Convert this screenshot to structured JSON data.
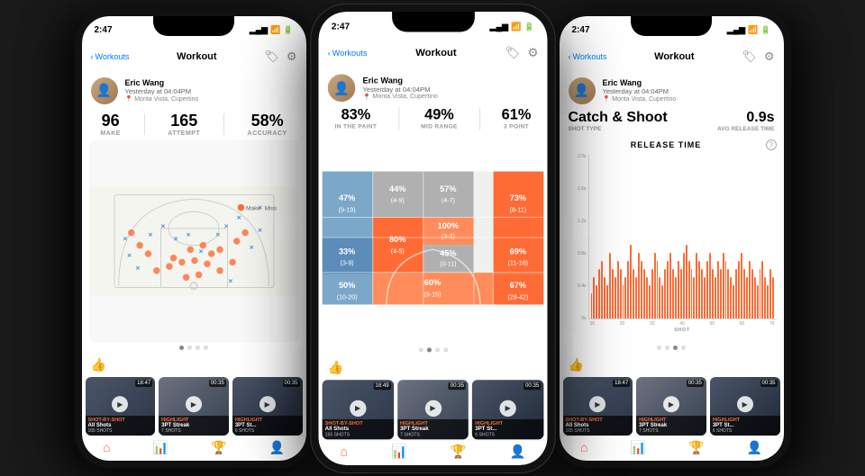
{
  "phones": [
    {
      "id": "phone1",
      "status": {
        "time": "2:47",
        "battery": "█████",
        "signal": "●●●●"
      },
      "nav": {
        "back_label": "Workouts",
        "title": "Workout",
        "tag_icon": "🏷",
        "gear_icon": "⚙"
      },
      "profile": {
        "name": "Eric Wang",
        "date": "Yesterday at 04:04PM",
        "location": "Monta Vista, Cupertino"
      },
      "stats": [
        {
          "value": "96",
          "label": "MAKE"
        },
        {
          "value": "165",
          "label": "ATTEMPT"
        },
        {
          "value": "58%",
          "label": "ACCURACY"
        }
      ],
      "chart_type": "shot_chart",
      "pagination": [
        true,
        false,
        false,
        false
      ],
      "videos": [
        {
          "duration": "18:47",
          "type": "SHOT-BY-SHOT",
          "name": "All Shots",
          "count": "165 SHOTS",
          "bg": "vbg1"
        },
        {
          "duration": "00:35",
          "type": "HIGHLIGHT",
          "name": "3PT Streak",
          "count": "7 SHOTS",
          "bg": "vbg2"
        },
        {
          "duration": "00:35",
          "type": "HIGHLIGHT",
          "name": "3PT St...",
          "count": "6 SHOTS",
          "bg": "vbg3"
        }
      ]
    },
    {
      "id": "phone2",
      "status": {
        "time": "2:47",
        "battery": "█████",
        "signal": "●●●●"
      },
      "nav": {
        "back_label": "Workouts",
        "title": "Workout",
        "tag_icon": "🏷",
        "gear_icon": "⚙"
      },
      "profile": {
        "name": "Eric Wang",
        "date": "Yesterday at 04:04PM",
        "location": "Monta Vista, Cupertino"
      },
      "pct_stats": [
        {
          "value": "83%",
          "label": "IN THE PAINT"
        },
        {
          "value": "49%",
          "label": "MID RANGE"
        },
        {
          "value": "61%",
          "label": "3 POINT"
        }
      ],
      "chart_type": "zones",
      "zones": [
        {
          "pct": "57%",
          "frac": "(4-7)",
          "color": "neutral",
          "col": 3,
          "row": 1
        },
        {
          "pct": "44%",
          "frac": "(4-9)",
          "color": "neutral",
          "col": 2,
          "row": 1
        },
        {
          "pct": "47%",
          "frac": "(9-19)",
          "color": "medium",
          "col": 1,
          "row": 1
        },
        {
          "pct": "73%",
          "frac": "(8-11)",
          "color": "hot",
          "col": 4,
          "row": 1
        },
        {
          "pct": "33%",
          "frac": "(3-9)",
          "color": "cool",
          "col": 2,
          "row": 2
        },
        {
          "pct": "80%",
          "frac": "(4-5)",
          "color": "hot",
          "col": 3,
          "row": 2
        },
        {
          "pct": "100%",
          "frac": "(3-3)",
          "color": "hot",
          "col": 2,
          "row": 2
        },
        {
          "pct": "45%",
          "frac": "(0-11)",
          "color": "neutral",
          "col": 3,
          "row": 2
        },
        {
          "pct": "50%",
          "frac": "(10-20)",
          "color": "medium",
          "col": 1,
          "row": 3
        },
        {
          "pct": "60%",
          "frac": "(9-15)",
          "color": "warm",
          "col": 2,
          "row": 3
        },
        {
          "pct": "67%",
          "frac": "(28-42)",
          "color": "warm",
          "col": 2,
          "row": 3
        },
        {
          "pct": "69%",
          "frac": "(11-16)",
          "color": "hot",
          "col": 3,
          "row": 3
        }
      ],
      "pagination": [
        false,
        true,
        false,
        false
      ],
      "videos": [
        {
          "duration": "18:49",
          "type": "SHOT-BY-SHOT",
          "name": "All Shots",
          "count": "165 SHOTS",
          "bg": "vbg1"
        },
        {
          "duration": "00:35",
          "type": "HIGHLIGHT",
          "name": "3PT Streak",
          "count": "7 SHOTS",
          "bg": "vbg2"
        },
        {
          "duration": "00:35",
          "type": "HIGHLIGHT",
          "name": "3PT St...",
          "count": "6 SHOTS",
          "bg": "vbg3"
        }
      ]
    },
    {
      "id": "phone3",
      "status": {
        "time": "2:47",
        "battery": "█████",
        "signal": "●●●●"
      },
      "nav": {
        "back_label": "Workouts",
        "title": "Workout",
        "tag_icon": "🏷",
        "gear_icon": "⚙"
      },
      "profile": {
        "name": "Eric Wang",
        "date": "Yesterday at 04:04PM",
        "location": "Monta Vista, Cupertino"
      },
      "catch_shoot": {
        "title": "Catch & Shoot",
        "shot_type_label": "SHOT TYPE",
        "value": "0.9s",
        "avg_label": "AVG RELEASE TIME"
      },
      "release_chart": {
        "title": "RELEASE TIME",
        "y_label": "RELEASE TIME",
        "x_labels": [
          "10",
          "20",
          "30",
          "40",
          "50",
          "60",
          "70"
        ],
        "x_axis_label": "SHOT",
        "y_axis_labels": [
          "2.0s",
          "1.6s",
          "1.2s",
          "0.8s",
          "0.4s",
          "0s"
        ],
        "bars": [
          0.3,
          0.5,
          0.4,
          0.6,
          0.7,
          0.5,
          0.4,
          0.8,
          0.6,
          0.5,
          0.7,
          0.6,
          0.4,
          0.5,
          0.7,
          0.9,
          0.6,
          0.5,
          0.8,
          0.7,
          0.6,
          0.5,
          0.4,
          0.6,
          0.8,
          0.7,
          0.5,
          0.4,
          0.6,
          0.7,
          0.8,
          0.6,
          0.5,
          0.7,
          0.6,
          0.8,
          0.9,
          0.7,
          0.6,
          0.5,
          0.8,
          0.7,
          0.6,
          0.5,
          0.7,
          0.8,
          0.6,
          0.5,
          0.7,
          0.6,
          0.8,
          0.7,
          0.6,
          0.5,
          0.4,
          0.6,
          0.7,
          0.8,
          0.6,
          0.5,
          0.7,
          0.6,
          0.5,
          0.4,
          0.6,
          0.7,
          0.5,
          0.4,
          0.6,
          0.5
        ]
      },
      "chart_type": "release",
      "pagination": [
        false,
        false,
        true,
        false
      ],
      "videos": [
        {
          "duration": "18:47",
          "type": "SHOT-BY-SHOT",
          "name": "All Shots",
          "count": "165 SHOTS",
          "bg": "vbg1"
        },
        {
          "duration": "00:35",
          "type": "HIGHLIGHT",
          "name": "3PT Streak",
          "count": "7 SHOTS",
          "bg": "vbg2"
        },
        {
          "duration": "00:35",
          "type": "HIGHLIGHT",
          "name": "3PT St...",
          "count": "6 SHOTS",
          "bg": "vbg3"
        }
      ]
    }
  ],
  "accent_color": "#FF6B35",
  "info_label": "?"
}
